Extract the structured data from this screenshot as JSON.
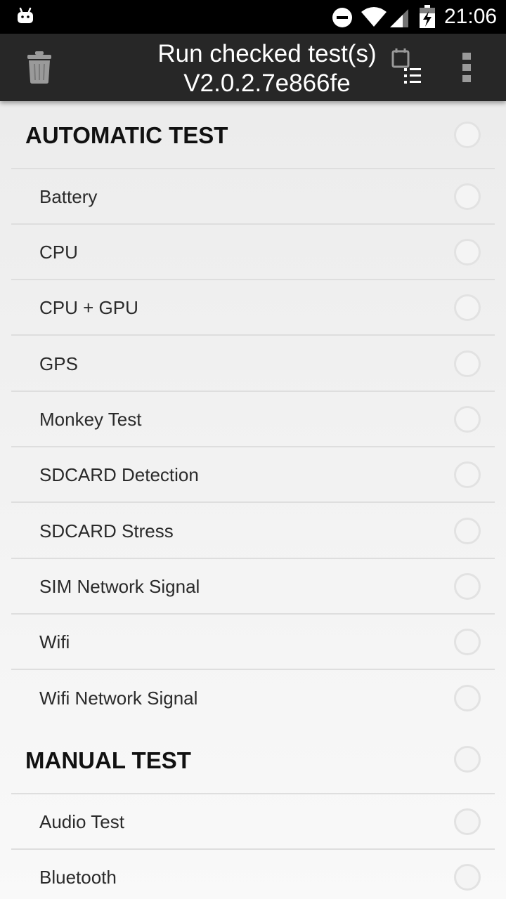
{
  "status_bar": {
    "time": "21:06",
    "icons": [
      "android-icon",
      "do-not-disturb-icon",
      "wifi-icon",
      "signal-icon",
      "battery-charging-icon"
    ]
  },
  "toolbar": {
    "title_line1": "Run checked test(s)",
    "title_line2": "V2.0.2.7e866fe",
    "icons": [
      "trash-icon",
      "run-list-icon",
      "more-vert-icon"
    ]
  },
  "sections": [
    {
      "title": "AUTOMATIC TEST",
      "items": [
        "Battery",
        "CPU",
        "CPU + GPU",
        "GPS",
        "Monkey Test",
        "SDCARD Detection",
        "SDCARD Stress",
        "SIM Network Signal",
        "Wifi",
        "Wifi Network Signal"
      ]
    },
    {
      "title": "MANUAL TEST",
      "items": [
        "Audio Test",
        "Bluetooth"
      ]
    }
  ]
}
